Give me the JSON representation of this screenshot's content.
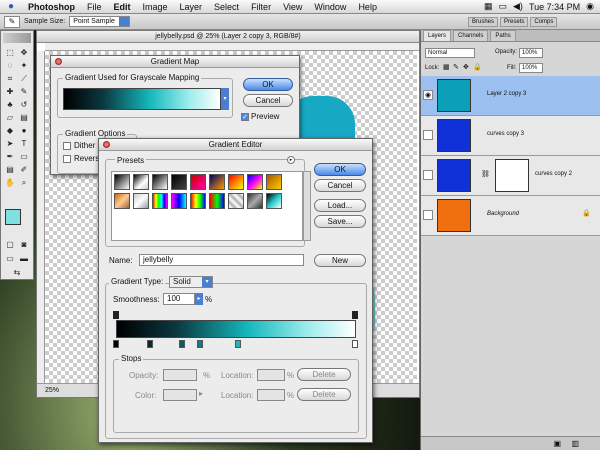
{
  "menubar": {
    "app_name": "Photoshop",
    "menus": [
      "File",
      "Edit",
      "Image",
      "Layer",
      "Select",
      "Filter",
      "View",
      "Window",
      "Help"
    ],
    "clock": "Tue 7:34 PM"
  },
  "options_bar": {
    "sample_size_label": "Sample Size:",
    "sample_size_value": "Point Sample",
    "palette_tabs": [
      "Brushes",
      "Presets",
      "Comps"
    ]
  },
  "document": {
    "title": "jellybelly.psd @ 25% (Layer 2 copy 3, RGB/8#)",
    "zoom": "25%"
  },
  "gradient_map": {
    "title": "Gradient Map",
    "group_label": "Gradient Used for Grayscale Mapping",
    "ok": "OK",
    "cancel": "Cancel",
    "preview_label": "Preview",
    "options_label": "Gradient Options",
    "dither_label": "Dither",
    "reverse_label": "Reverse"
  },
  "gradient_editor": {
    "title": "Gradient Editor",
    "presets_label": "Presets",
    "ok": "OK",
    "cancel": "Cancel",
    "load": "Load...",
    "save": "Save...",
    "name_label": "Name:",
    "name_value": "jellybelly",
    "new": "New",
    "type_label": "Gradient Type:",
    "type_value": "Solid",
    "smoothness_label": "Smoothness:",
    "smoothness_value": "100",
    "percent": "%",
    "stops_label": "Stops",
    "opacity_label": "Opacity:",
    "color_label": "Color:",
    "location_label": "Location:",
    "delete": "Delete"
  },
  "layers_panel": {
    "tabs": [
      "Layers",
      "Channels",
      "Paths"
    ],
    "blend_mode": "Normal",
    "opacity_label": "Opacity:",
    "opacity_value": "100%",
    "lock_label": "Lock:",
    "fill_label": "Fill:",
    "fill_value": "100%",
    "layers": [
      {
        "name": "Layer 2 copy 3"
      },
      {
        "name": "curves copy 3"
      },
      {
        "name": "curves copy 2"
      },
      {
        "name": "Background"
      }
    ]
  }
}
